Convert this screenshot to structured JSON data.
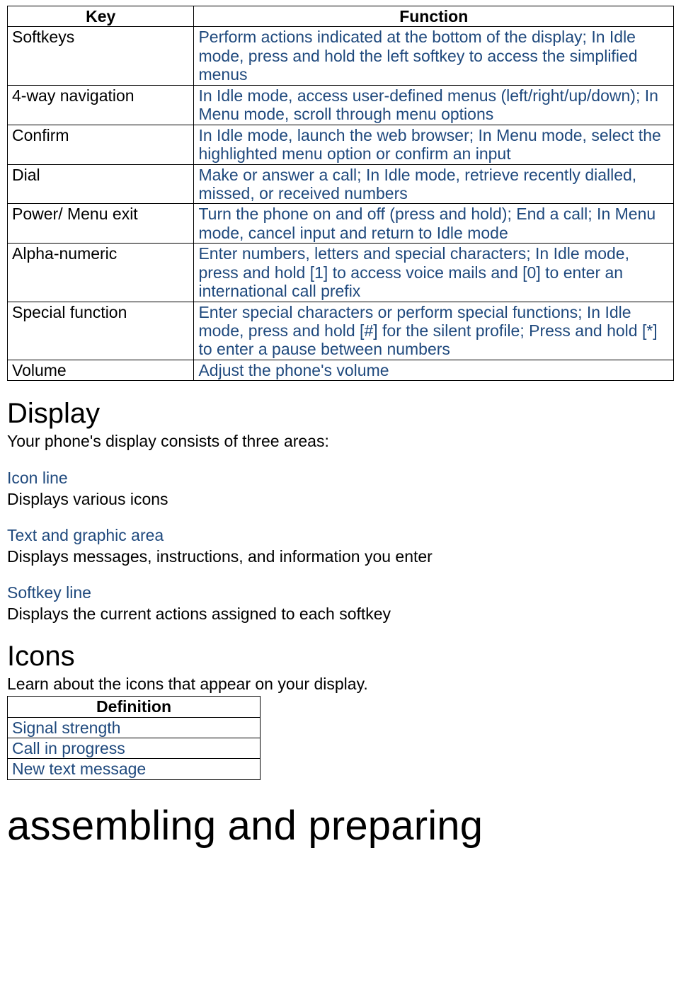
{
  "tables": {
    "keys": {
      "headers": {
        "key": "Key",
        "func": "Function"
      },
      "rows": [
        {
          "key": "Softkeys",
          "func": "Perform actions indicated at the bottom of the display; In Idle mode, press and hold the left softkey to access the simplified menus"
        },
        {
          "key": "4-way navigation",
          "func": "In Idle mode, access user-defined menus (left/right/up/down); In Menu mode, scroll through menu options"
        },
        {
          "key": "Confirm",
          "func": "In Idle mode, launch the web browser; In Menu mode, select the highlighted menu option or confirm an input"
        },
        {
          "key": "Dial",
          "func": "Make or answer a call; In Idle mode, retrieve recently dialled, missed, or received numbers"
        },
        {
          "key": "Power/ Menu exit",
          "func": "Turn the phone on and off (press and hold); End a call; In Menu mode, cancel input and return to Idle mode"
        },
        {
          "key": "Alpha-numeric",
          "func": "Enter numbers, letters and special characters; In Idle mode, press and hold [1] to access voice mails and [0] to enter an international call prefix"
        },
        {
          "key": "Special function",
          "func": "Enter special characters or perform special functions; In Idle mode, press and hold [#] for the silent profile; Press and hold [*] to enter a pause between numbers"
        },
        {
          "key": "Volume",
          "func": "Adjust the phone's volume"
        }
      ]
    },
    "defs": {
      "header": "Definition",
      "rows": [
        "Signal strength",
        "Call in progress",
        "New text message"
      ]
    }
  },
  "sections": {
    "display": {
      "heading": "Display",
      "intro": "Your phone's display consists of three areas:",
      "areas": [
        {
          "title": "Icon line",
          "desc": "Displays various icons"
        },
        {
          "title": "Text and graphic area",
          "desc": "Displays messages, instructions, and information you enter"
        },
        {
          "title": "Softkey line",
          "desc": "Displays the current actions assigned to each softkey"
        }
      ]
    },
    "icons": {
      "heading": "Icons",
      "intro": "Learn about the icons that appear on your display."
    },
    "assembling": {
      "heading": "assembling and preparing"
    }
  }
}
